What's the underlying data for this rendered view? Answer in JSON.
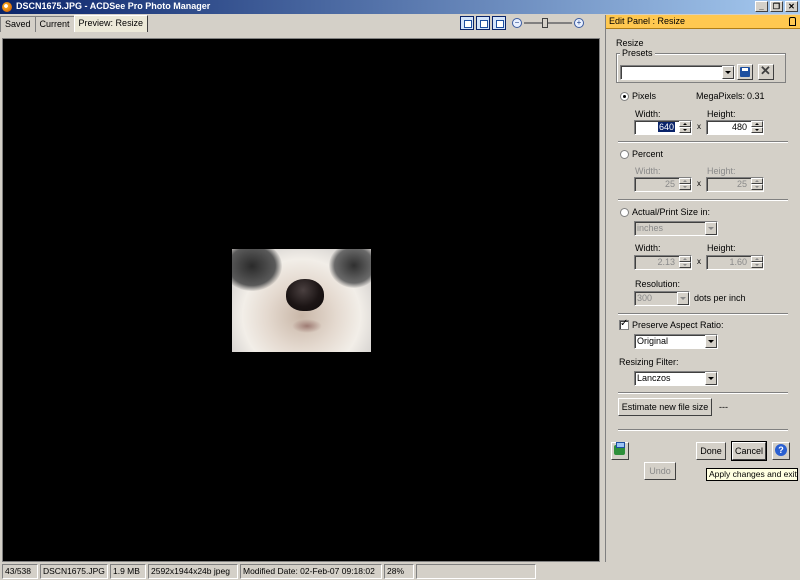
{
  "window": {
    "title": "DSCN1675.JPG - ACDSee Pro Photo Manager",
    "controls": [
      "_",
      "❐",
      "✕"
    ]
  },
  "tabs": [
    {
      "label": "Saved"
    },
    {
      "label": "Current"
    },
    {
      "label": "Preview: Resize",
      "active": true
    }
  ],
  "panel": {
    "title": "Edit Panel : Resize",
    "section": "Resize",
    "presets": {
      "label": "Presets",
      "value": ""
    },
    "pixels": {
      "label": "Pixels",
      "megapixels_label": "MegaPixels:",
      "megapixels_value": "0.31",
      "width_label": "Width:",
      "height_label": "Height:",
      "width": "640",
      "height": "480",
      "times": "x"
    },
    "percent": {
      "label": "Percent",
      "width_label": "Width:",
      "height_label": "Height:",
      "width": "25",
      "height": "25",
      "times": "x"
    },
    "actual": {
      "label": "Actual/Print Size in:",
      "unit": "inches",
      "width_label": "Width:",
      "height_label": "Height:",
      "width": "2.13",
      "height": "1.60",
      "times": "x",
      "resolution_label": "Resolution:",
      "resolution": "300",
      "resolution_unit": "dots per inch"
    },
    "aspect": {
      "label": "Preserve Aspect Ratio:",
      "value": "Original"
    },
    "filter": {
      "label": "Resizing Filter:",
      "value": "Lanczos"
    },
    "estimate": {
      "button": "Estimate new file size",
      "result": "---"
    },
    "buttons": {
      "done": "Done",
      "cancel": "Cancel",
      "undo": "Undo",
      "help": "?"
    },
    "tooltip": "Apply changes and exit"
  },
  "status": {
    "index": "43/538",
    "filename": "DSCN1675.JPG",
    "size": "1.9 MB",
    "dimensions": "2592x1944x24b jpeg",
    "modified": "Modified Date: 02-Feb-07 09:18:02",
    "zoom": "28%",
    "extra": ""
  },
  "colors": {
    "panel_header": "#ffc850",
    "titlebar": "#0a246a"
  }
}
